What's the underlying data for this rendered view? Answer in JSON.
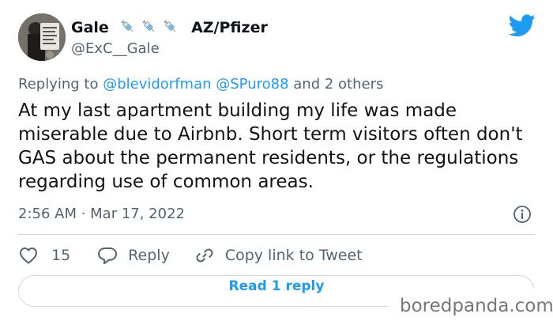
{
  "tweet": {
    "display_name": "Gale",
    "name_suffix": "AZ/Pfizer",
    "handle": "@ExC__Gale",
    "replying_prefix": "Replying to",
    "replying_mentions": "@blevidorfman @SPuro88",
    "replying_others": "and 2 others",
    "text": "At my last apartment building my life was made miserable due to Airbnb. Short term visitors often don't GAS about the permanent residents, or the regulations regarding use of common areas.",
    "timestamp": "2:56 AM · Mar 17, 2022"
  },
  "actions": {
    "like_count": "15",
    "reply_label": "Reply",
    "copy_link_label": "Copy link to Tweet"
  },
  "read_replies_label": "Read 1 reply",
  "watermark": "boredpanda.com",
  "icons": {
    "verified_emoji": "syringe-icon",
    "brand": "twitter-bird-icon",
    "info": "info-icon",
    "like": "heart-icon",
    "reply": "speech-bubble-icon",
    "copy": "link-icon"
  },
  "colors": {
    "twitter_blue": "#1d9bf0",
    "text_primary": "#0f1419",
    "text_secondary": "#536471",
    "divider": "#cfd9de",
    "watermark_gray": "#777777"
  }
}
